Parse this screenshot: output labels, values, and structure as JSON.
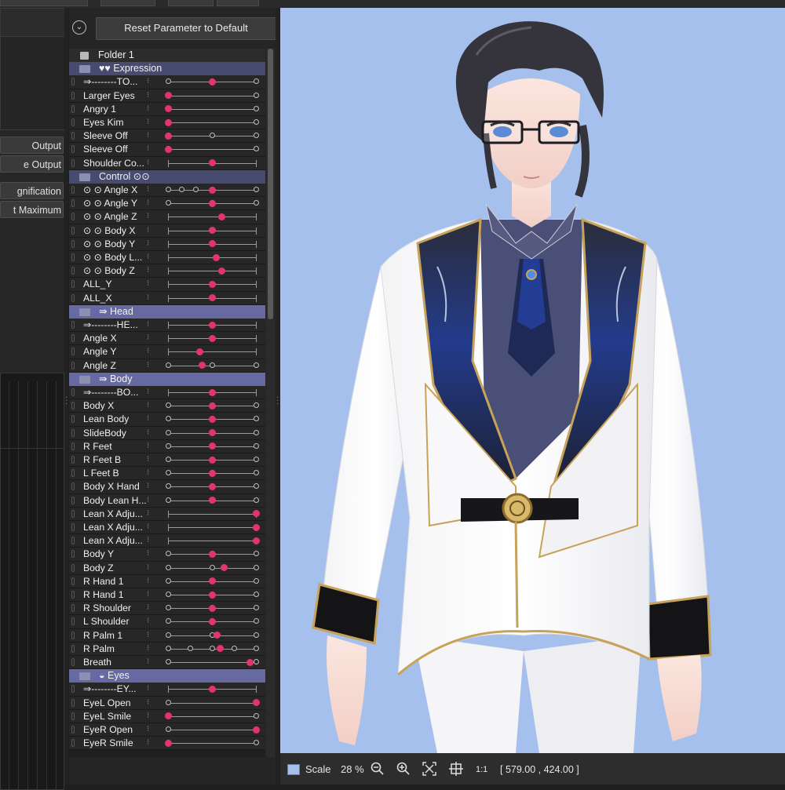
{
  "toolbar": {
    "reset_label": "Reset Parameter to Default"
  },
  "left_panel": {
    "buttons": [
      "Output",
      "e Output",
      "gnification",
      "t Maximum"
    ]
  },
  "params": [
    {
      "type": "folder",
      "label": "Folder 1"
    },
    {
      "type": "group",
      "label": "♥♥ Expression",
      "light": false
    },
    {
      "type": "param",
      "label": "⇒--------TO...",
      "val": 0.5,
      "kf": [
        0,
        0.5,
        1
      ]
    },
    {
      "type": "param",
      "label": "Larger Eyes",
      "val": 0,
      "kf": [
        0,
        1
      ]
    },
    {
      "type": "param",
      "label": "Angry 1",
      "val": 0,
      "kf": [
        0,
        1
      ]
    },
    {
      "type": "param",
      "label": "Eyes Kim",
      "val": 0,
      "kf": [
        0,
        1
      ]
    },
    {
      "type": "param",
      "label": "Sleeve Off",
      "val": 0,
      "kf": [
        0,
        0.5,
        1
      ]
    },
    {
      "type": "param",
      "label": "Sleeve Off",
      "val": 0,
      "kf": [
        0,
        1
      ]
    },
    {
      "type": "param",
      "label": "Shoulder Co...",
      "val": 0.5,
      "kf": [],
      "ticks": true
    },
    {
      "type": "group",
      "label": "Control  ⊙⊙",
      "light": false
    },
    {
      "type": "param",
      "label": "⊙ ⊙ Angle X",
      "val": 0.5,
      "kf": [
        0,
        0.16,
        0.32,
        0.5,
        1
      ]
    },
    {
      "type": "param",
      "label": "⊙ ⊙ Angle Y",
      "val": 0.5,
      "kf": [
        0,
        0.5,
        1
      ]
    },
    {
      "type": "param",
      "label": "⊙ ⊙ Angle Z",
      "val": 0.61,
      "kf": [],
      "ticks": true
    },
    {
      "type": "param",
      "label": "⊙ ⊙ Body X",
      "val": 0.5,
      "kf": [],
      "ticks": true
    },
    {
      "type": "param",
      "label": "⊙ ⊙ Body Y",
      "val": 0.5,
      "kf": [],
      "ticks": true
    },
    {
      "type": "param",
      "label": "⊙ ⊙ Body L...",
      "val": 0.55,
      "kf": [],
      "ticks": true
    },
    {
      "type": "param",
      "label": "⊙ ⊙ Body Z",
      "val": 0.61,
      "kf": [],
      "ticks": true
    },
    {
      "type": "param",
      "label": "ALL_Y",
      "val": 0.5,
      "kf": [],
      "ticks": true
    },
    {
      "type": "param",
      "label": "ALL_X",
      "val": 0.5,
      "kf": [],
      "ticks": true
    },
    {
      "type": "group",
      "label": "⇛ Head",
      "light": true
    },
    {
      "type": "param",
      "label": "⇒--------HE...",
      "val": 0.5,
      "kf": [],
      "ticks": true
    },
    {
      "type": "param",
      "label": "Angle X",
      "val": 0.5,
      "kf": [],
      "ticks": true
    },
    {
      "type": "param",
      "label": "Angle Y",
      "val": 0.36,
      "kf": [],
      "ticks": true
    },
    {
      "type": "param",
      "label": "Angle Z",
      "val": 0.39,
      "kf": [
        0,
        0.5,
        1
      ]
    },
    {
      "type": "group",
      "label": "⇛ Body",
      "light": true
    },
    {
      "type": "param",
      "label": "⇒--------BO...",
      "val": 0.5,
      "kf": [],
      "ticks": true
    },
    {
      "type": "param",
      "label": "Body X",
      "val": 0.5,
      "kf": [
        0,
        0.5,
        1
      ]
    },
    {
      "type": "param",
      "label": "Lean Body",
      "val": 0.5,
      "kf": [
        0,
        0.5,
        1
      ]
    },
    {
      "type": "param",
      "label": "SlideBody",
      "val": 0.5,
      "kf": [
        0,
        0.5,
        1
      ]
    },
    {
      "type": "param",
      "label": "R Feet",
      "val": 0.5,
      "kf": [
        0,
        0.5,
        1
      ]
    },
    {
      "type": "param",
      "label": "R Feet B",
      "val": 0.5,
      "kf": [
        0,
        0.5,
        1
      ]
    },
    {
      "type": "param",
      "label": "L Feet B",
      "val": 0.5,
      "kf": [
        0,
        0.5,
        1
      ]
    },
    {
      "type": "param",
      "label": "Body X Hand",
      "val": 0.5,
      "kf": [
        0,
        0.5,
        1
      ]
    },
    {
      "type": "param",
      "label": "Body Lean H...",
      "val": 0.5,
      "kf": [
        0,
        0.5,
        1
      ]
    },
    {
      "type": "param",
      "label": "Lean X Adju...",
      "val": 1,
      "kf": [],
      "ticks": true
    },
    {
      "type": "param",
      "label": "Lean X Adju...",
      "val": 1,
      "kf": [],
      "ticks": true
    },
    {
      "type": "param",
      "label": "Lean X Adju...",
      "val": 1,
      "kf": [],
      "ticks": true
    },
    {
      "type": "param",
      "label": "Body Y",
      "val": 0.5,
      "kf": [
        0,
        0.5,
        1
      ]
    },
    {
      "type": "param",
      "label": "Body Z",
      "val": 0.64,
      "kf": [
        0,
        0.5,
        1
      ]
    },
    {
      "type": "param",
      "label": "R Hand 1",
      "val": 0.5,
      "kf": [
        0,
        0.5,
        1
      ]
    },
    {
      "type": "param",
      "label": "R Hand 1",
      "val": 0.5,
      "kf": [
        0,
        0.5,
        1
      ]
    },
    {
      "type": "param",
      "label": "R Shoulder",
      "val": 0.5,
      "kf": [
        0,
        0.5,
        1
      ]
    },
    {
      "type": "param",
      "label": "L Shoulder",
      "val": 0.5,
      "kf": [
        0,
        0.5,
        1
      ]
    },
    {
      "type": "param",
      "label": "R Palm 1",
      "val": 0.56,
      "kf": [
        0,
        0.5,
        1
      ]
    },
    {
      "type": "param",
      "label": "R Palm",
      "val": 0.59,
      "kf": [
        0,
        0.25,
        0.5,
        0.75,
        1
      ]
    },
    {
      "type": "param",
      "label": "Breath",
      "val": 0.93,
      "kf": [
        0,
        1
      ]
    },
    {
      "type": "group",
      "label": "◒ Eyes",
      "light": true
    },
    {
      "type": "param",
      "label": "⇒--------EY...",
      "val": 0.5,
      "kf": [],
      "ticks": true
    },
    {
      "type": "param",
      "label": "EyeL Open",
      "val": 1,
      "kf": [
        0,
        1
      ]
    },
    {
      "type": "param",
      "label": "EyeL Smile",
      "val": 0,
      "kf": [
        0,
        1
      ]
    },
    {
      "type": "param",
      "label": "EyeR Open",
      "val": 1,
      "kf": [
        0,
        1
      ]
    },
    {
      "type": "param",
      "label": "EyeR Smile",
      "val": 0,
      "kf": [
        0,
        1
      ]
    }
  ],
  "status": {
    "scale_label": "Scale",
    "scale_value": "28 %",
    "ratio": "1:1",
    "coords": "[  579.00 ,  424.00 ]"
  },
  "colors": {
    "canvas_bg": "#a5c0ec",
    "value_dot": "#e2356e",
    "group_header": "#474b6f",
    "group_header_light": "#6769a3"
  },
  "icons": [
    "collapse-chevron-icon",
    "folder-icon",
    "zoom-out-icon",
    "zoom-in-icon",
    "fit-screen-icon",
    "center-target-icon"
  ]
}
